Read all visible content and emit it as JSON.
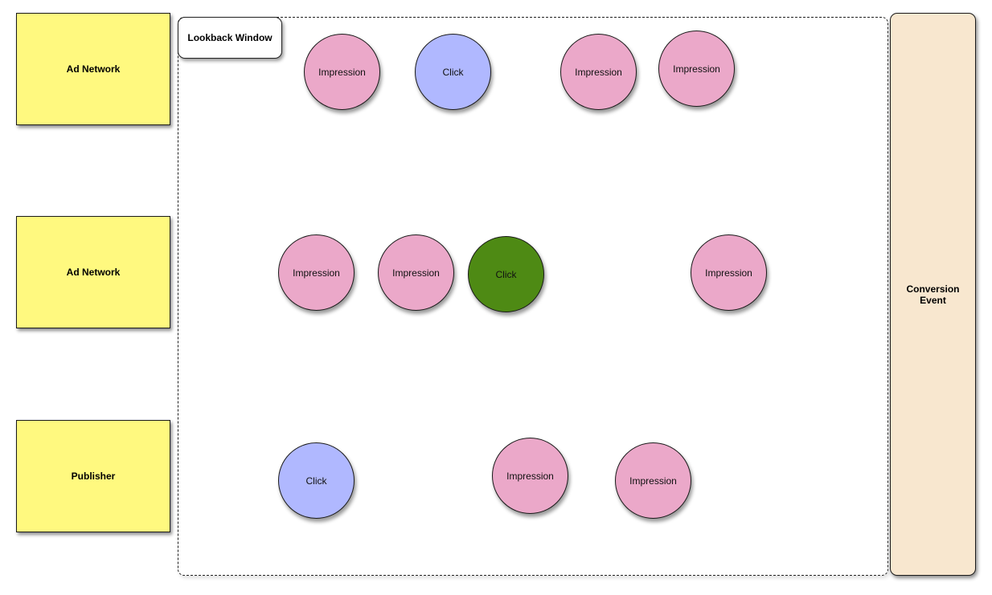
{
  "colors": {
    "source": "#fff97f",
    "impression": "#eba8c9",
    "click": "#b0b8ff",
    "click_highlight": "#4e8a14",
    "conversion": "#f8e7cf"
  },
  "sources": [
    {
      "label": "Ad Network"
    },
    {
      "label": "Ad Network"
    },
    {
      "label": "Publisher"
    }
  ],
  "lookback_window": {
    "label": "Lookback Window"
  },
  "conversion": {
    "label": "Conversion\nEvent"
  },
  "events": [
    {
      "label": "Impression",
      "type": "impression",
      "row": 0
    },
    {
      "label": "Click",
      "type": "click",
      "row": 0
    },
    {
      "label": "Impression",
      "type": "impression",
      "row": 0
    },
    {
      "label": "Impression",
      "type": "impression",
      "row": 0
    },
    {
      "label": "Impression",
      "type": "impression",
      "row": 1
    },
    {
      "label": "Impression",
      "type": "impression",
      "row": 1
    },
    {
      "label": "Click",
      "type": "click_highlight",
      "row": 1
    },
    {
      "label": "Impression",
      "type": "impression",
      "row": 1
    },
    {
      "label": "Click",
      "type": "click",
      "row": 2
    },
    {
      "label": "Impression",
      "type": "impression",
      "row": 2
    },
    {
      "label": "Impression",
      "type": "impression",
      "row": 2
    }
  ]
}
